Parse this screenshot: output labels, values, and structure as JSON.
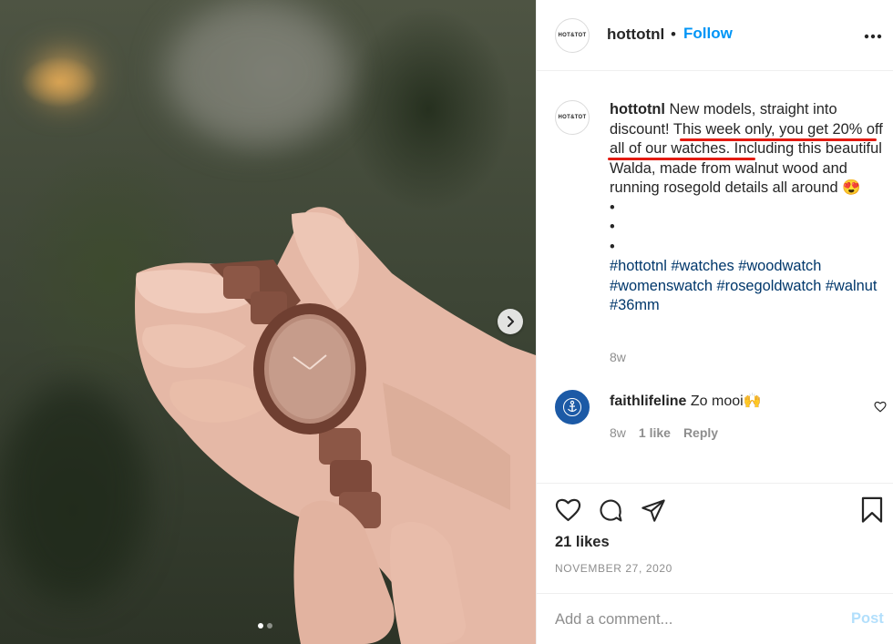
{
  "post": {
    "brand_logo_text": "HOT&TOT",
    "username": "hottotnl",
    "separator": "•",
    "follow_label": "Follow",
    "more_icon": "more-options-icon"
  },
  "caption": {
    "username": "hottotnl",
    "text_part1": "New models, straight into discount! ",
    "text_highlight1": "This week only, you get 20%",
    "text_highlight2": "off all of our watches",
    "text_part2": ". Including this beautiful Walda, made from walnut wood and running rosegold details all around 😍",
    "bullets": [
      "•",
      "•",
      "•"
    ],
    "hashtags": "#hottotnl #watches #woodwatch #womenswatch #rosegoldwatch #walnut #36mm",
    "time": "8w",
    "highlight_color": "#e31b12"
  },
  "comment": {
    "username": "faithlifeline",
    "text": "Zo mooi🙌",
    "time": "8w",
    "likes": "1 like",
    "reply_label": "Reply",
    "avatar_color": "#1c5aa6"
  },
  "stats": {
    "likes": "21 likes",
    "date": "NOVEMBER 27, 2020"
  },
  "composer": {
    "placeholder": "Add a comment...",
    "post_label": "Post"
  },
  "carousel": {
    "slide_count": 2,
    "active_slide": 1
  },
  "colors": {
    "link_blue": "#0095f6",
    "hashtag_blue": "#00376b",
    "muted": "#8e8e8e",
    "post_disabled": "#b2dffc"
  }
}
